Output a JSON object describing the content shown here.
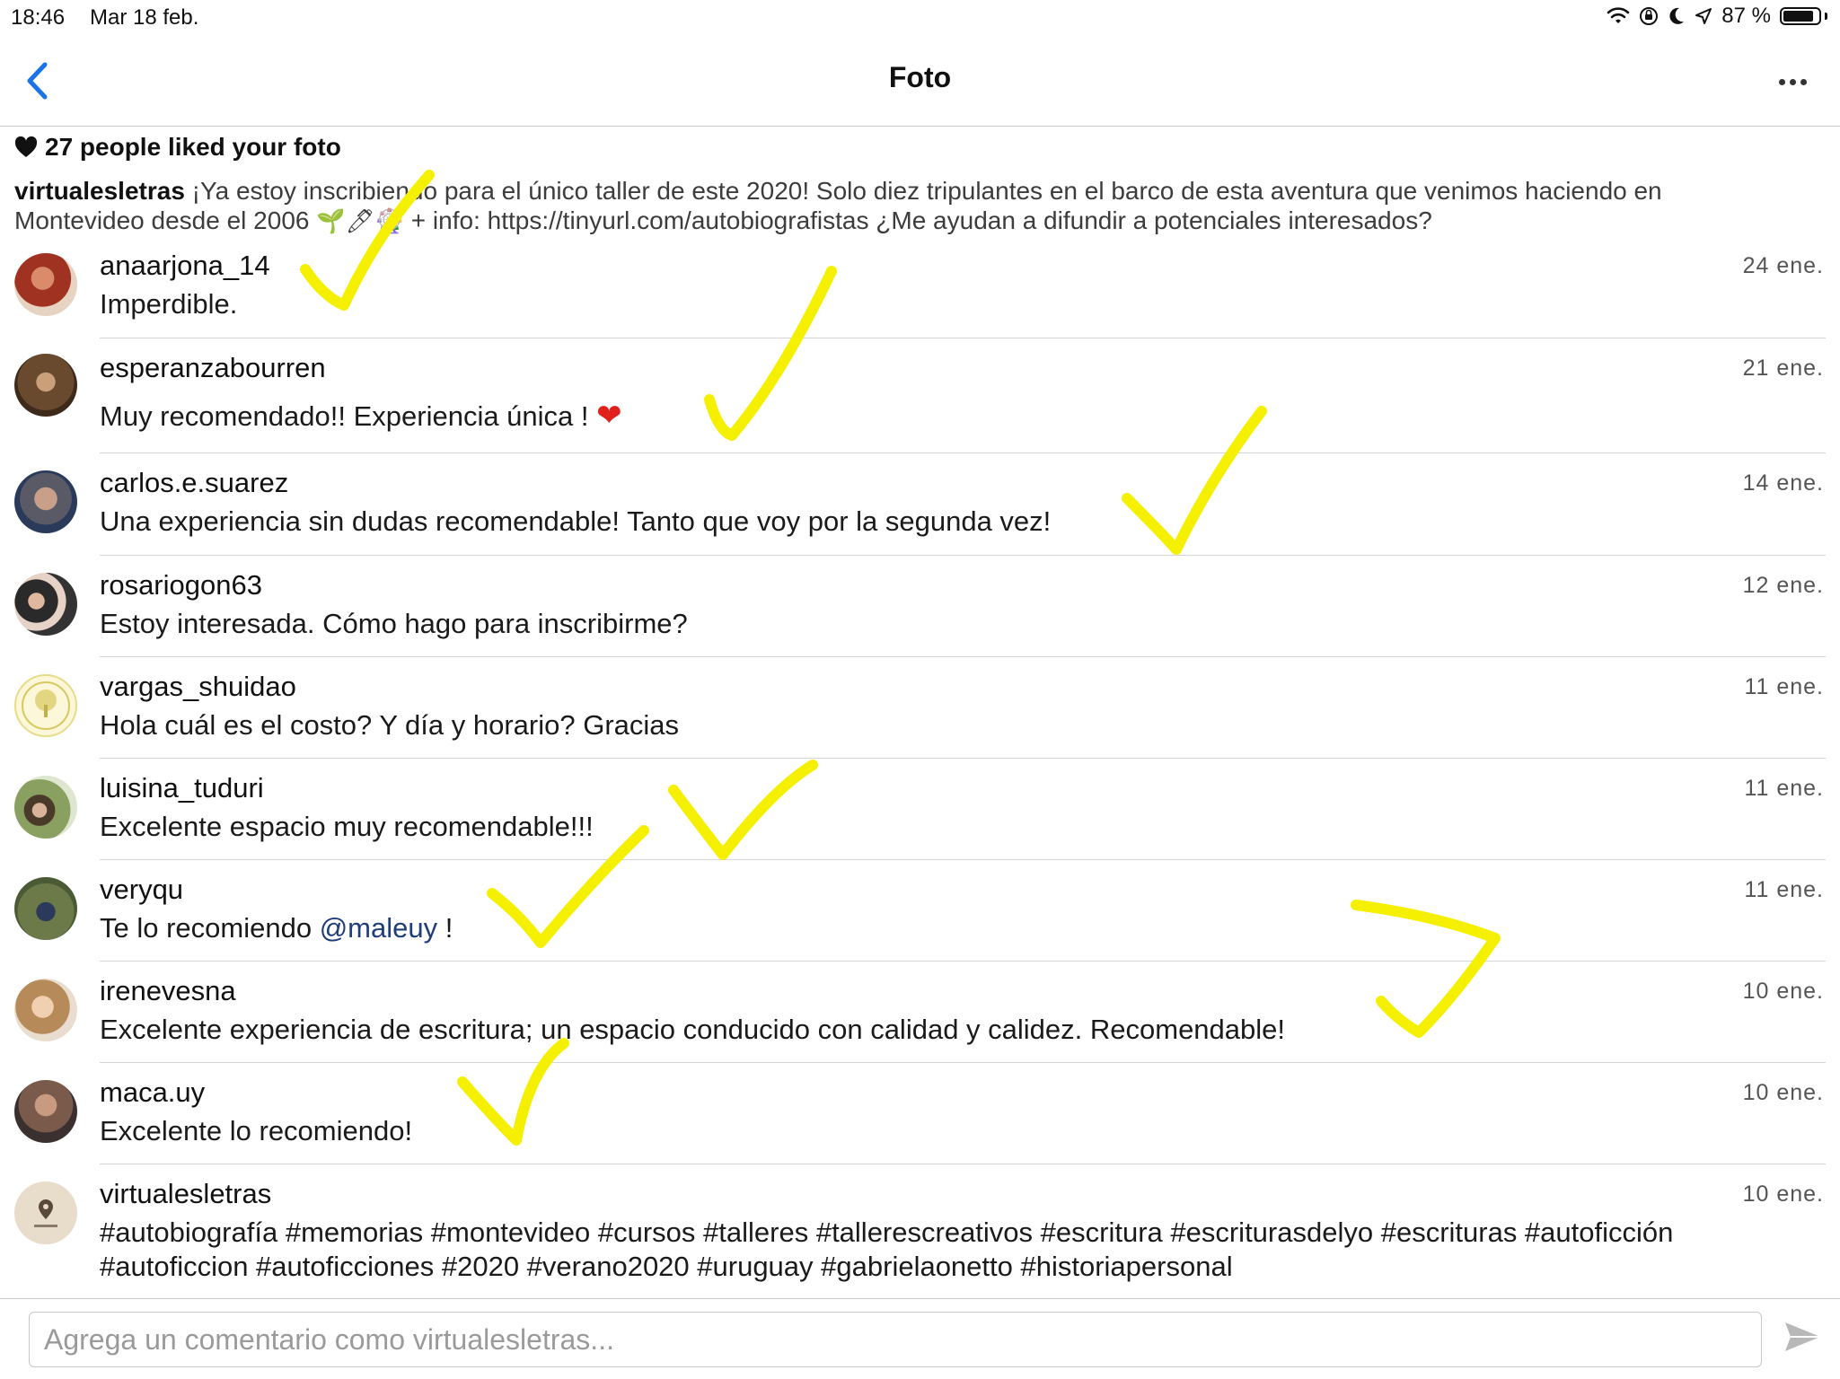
{
  "status_bar": {
    "time": "18:46",
    "date": "Mar 18 feb.",
    "battery_text": "87 %",
    "battery_level": 0.87
  },
  "nav": {
    "title": "Foto",
    "back_icon": "chevron-left-icon",
    "more_icon": "ellipsis-icon"
  },
  "likes": {
    "text": "27 people liked your foto"
  },
  "caption": {
    "username": "virtualesletras",
    "text_line1": "¡Ya estoy inscribiendo para el único taller de este 2020! Solo diez tripulantes en el barco de esta aventura que venimos haciendo en",
    "text_line2a": "Montevideo desde el 2006",
    "emojis": "🌱🖊🎡",
    "text_line2b": "+ info: https://tinyurl.com/autobiografistas ¿Me ayudan a difundir a potenciales interesados?"
  },
  "comments": [
    {
      "username": "anaarjona_14",
      "text": "Imperdible.",
      "date": "24 ene."
    },
    {
      "username": "esperanzabourren",
      "text": "Muy recomendado!! Experiencia única !",
      "emoji": "❤",
      "date": "21 ene."
    },
    {
      "username": "carlos.e.suarez",
      "text": "Una experiencia sin dudas recomendable! Tanto que voy por la segunda vez!",
      "date": "14 ene."
    },
    {
      "username": "rosariogon63",
      "text": "Estoy interesada. Cómo hago para inscribirme?",
      "date": "12 ene."
    },
    {
      "username": "vargas_shuidao",
      "text": "Hola cuál es el costo? Y día y horario? Gracias",
      "date": "11 ene."
    },
    {
      "username": "luisina_tuduri",
      "text": "Excelente espacio muy recomendable!!!",
      "date": "11 ene."
    },
    {
      "username": "veryqu",
      "text": "Te lo recomiendo ",
      "mention": "@maleuy",
      "text_after": " !",
      "date": "11 ene."
    },
    {
      "username": "irenevesna",
      "text": "Excelente experiencia de escritura; un espacio conducido con calidad y calidez. Recomendable!",
      "date": "10 ene."
    },
    {
      "username": "maca.uy",
      "text": "Excelente lo recomiendo!",
      "date": "10 ene."
    },
    {
      "username": "virtualesletras",
      "text": "#autobiografía #memorias #montevideo #cursos #talleres #tallerescreativos #escritura #escriturasdelyo #escrituras #autoficción",
      "text_line2": "#autoficcion #autoficciones #2020 #verano2020 #uruguay #gabrielaonetto #historiapersonal",
      "date": "10 ene."
    }
  ],
  "input": {
    "placeholder": "Agrega un comentario como virtualesletras..."
  },
  "colors": {
    "accent": "#1a73e8",
    "annotation": "#f4f000"
  }
}
